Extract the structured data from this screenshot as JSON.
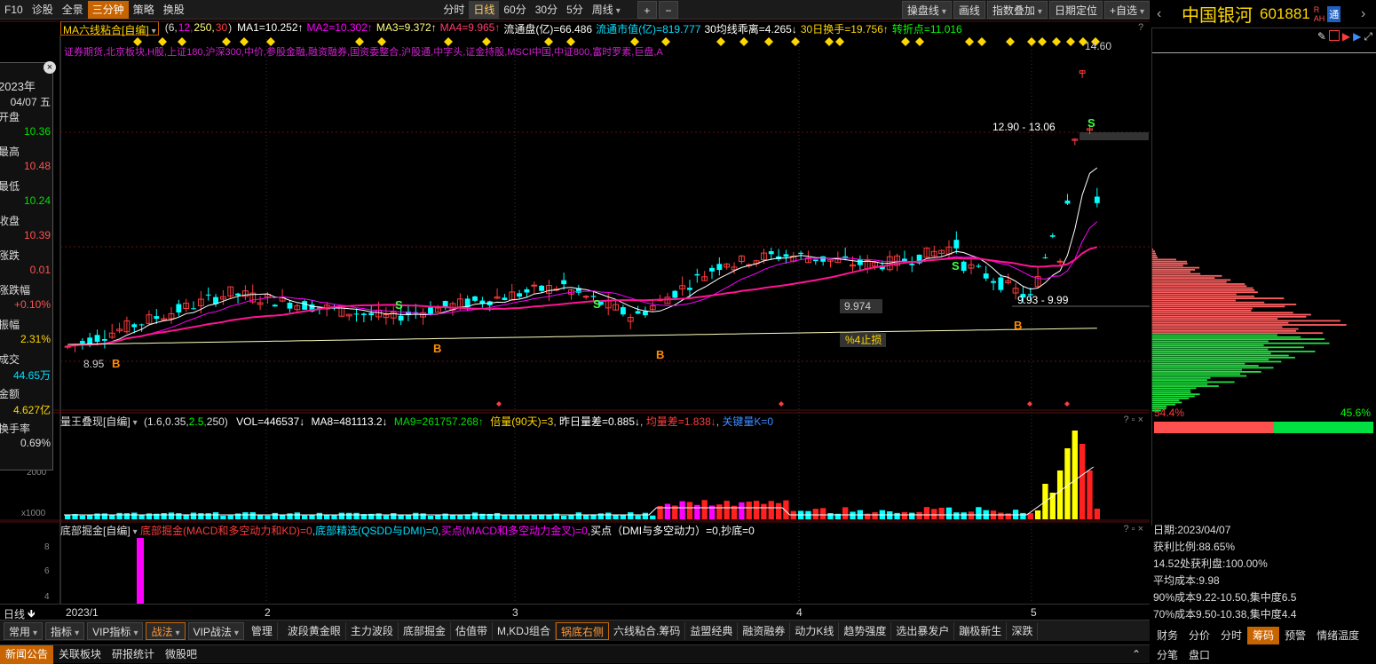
{
  "toolbar": {
    "left": [
      "F10",
      "诊股",
      "全景",
      "三分钟",
      "策略",
      "换股"
    ],
    "active_left": "三分钟",
    "periods": [
      "分时",
      "日线",
      "60分",
      "30分",
      "5分",
      "周线"
    ],
    "active_period": "日线",
    "zoom_in": "+",
    "zoom_out": "−",
    "right": [
      "操盘线",
      "画线",
      "指数叠加",
      "日期定位",
      "+自选"
    ]
  },
  "stock": {
    "name": "中国银河",
    "code": "601881",
    "badge_r": "R",
    "badge_ah": "AH",
    "badge_tong": "通",
    "prev": "‹",
    "next": "›"
  },
  "main_indicator": {
    "name": "MA六线粘合[自编]",
    "params_open": "(6,",
    "p1": "12,",
    "p2": "250,",
    "p3": "30",
    "params_close": ")",
    "ma1": "MA1=10.252↑",
    "ma2": "MA2=10.302↑",
    "ma3": "MA3=9.372↑",
    "ma4": "MA4=9.965↑",
    "float": "流通盘(亿)=66.486",
    "mcap": "流通市值(亿)=819.777",
    "dev": "30均线乖离=4.265↓",
    "turn": "30日换手=19.756↑",
    "pivot": "转折点=11.016",
    "help": "?"
  },
  "tags": "证券期货,北京板块,H股,上证180,沪深300,中价,参股金融,融资融券,国资委整合,沪股通,中字头,证金持股,MSCI中国,中证800,富时罗素,巨盘,A",
  "hq_panel": {
    "year": "2023年",
    "date": "04/07 五",
    "rows": [
      {
        "label": "开盘",
        "value": "10.36",
        "color": "#00e000"
      },
      {
        "label": "最高",
        "value": "10.48",
        "color": "#ff5050"
      },
      {
        "label": "最低",
        "value": "10.24",
        "color": "#00e000"
      },
      {
        "label": "收盘",
        "value": "10.39",
        "color": "#ff5050"
      },
      {
        "label": "涨跌",
        "value": "0.01",
        "color": "#ff5050"
      },
      {
        "label": "涨跌幅",
        "value": "+0.10%",
        "color": "#ff5050"
      },
      {
        "label": "振幅",
        "value": "2.31%",
        "color": "#ffd700"
      },
      {
        "label": "成交",
        "value": "44.65万",
        "color": "#00e0ff"
      },
      {
        "label": "金额",
        "value": "4.627亿",
        "color": "#ffd700"
      },
      {
        "label": "换手率",
        "value": "0.69%",
        "color": "#ddd"
      }
    ],
    "close_icon": "×"
  },
  "chart_labels": {
    "high": "14.60",
    "low": "8.95",
    "zone1": "12.90 - 13.06",
    "zone2": "9.93 - 9.99",
    "ma_val": "9.974",
    "stop": "%4止损",
    "buy": "B",
    "sell": "S"
  },
  "vol_indicator": {
    "name": "量王叠现[自编]",
    "p_open": "(1.6,0.35,",
    "p_hl": "2.5,",
    "p_close": "250)",
    "vol": "VOL=446537↓",
    "ma8": "MA8=481113.2↓",
    "ma9": "MA9=261757.268↑",
    "bei": "倍量(90天)=3",
    "diff": "昨日量差=0.885↓",
    "avg": "均量差=1.838↓",
    "key": "关键量K=0",
    "axis_top": "2000",
    "axis_unit": "x1000"
  },
  "bottom_indicator": {
    "name": "底部掘金[自编]",
    "t1": "底部掘金(MACD和多空动力和KD)=0",
    "t2": "底部精选(QSDD与DMI)=0",
    "t3": "买点(MACD和多空动力金叉)=0",
    "t4": "买点（DMI与多空动力）=0",
    "t5": "抄底=0",
    "y_labels": [
      "8",
      "6",
      "4"
    ]
  },
  "panel_ctl": "? ▫ ×",
  "x_axis": {
    "period_label": "日线",
    "ticks": [
      "2023/1",
      "2",
      "3",
      "4",
      "5"
    ]
  },
  "bottom_groups": [
    "常用",
    "指标",
    "VIP指标",
    "战法",
    "VIP战法"
  ],
  "bottom_manage": "管理",
  "bottom_tabs": [
    "波段黄金眼",
    "主力波段",
    "底部掘金",
    "估值带",
    "M,KDJ组合",
    "锅底右侧",
    "六线粘合.筹码",
    "益盟经典",
    "融资融券",
    "动力K线",
    "趋势强度",
    "选出暴发户",
    "蹦极新生",
    "深跌"
  ],
  "bottom_tab_selected": "锅底右侧",
  "news_tabs": [
    "新闻公告",
    "关联板块",
    "研报统计",
    "微股吧"
  ],
  "news_selected": "新闻公告",
  "news_collapse": "⌃",
  "chips": {
    "left_pct": "54.4%",
    "right_pct": "45.6%",
    "date": "日期:2023/04/07",
    "profit": "获利比例:88.65%",
    "price_profit": "14.52处获利盘:100.00%",
    "avg_cost": "平均成本:9.98",
    "c90": "90%成本9.22-10.50,集中度6.5",
    "c70": "70%成本9.50-10.38,集中度4.4"
  },
  "right_tabs": [
    "财务",
    "分价",
    "分时",
    "筹码",
    "预警",
    "情绪温度"
  ],
  "right_tab_selected": "筹码",
  "right_tabs2": [
    "分笔",
    "盘口"
  ],
  "colors": {
    "up": "#ff3c3c",
    "down": "#00ffff",
    "accent": "#c86400",
    "ma_white": "#ffffff",
    "ma_magenta": "#ff00ff",
    "ma_pink": "#ff1493",
    "ma_yellow": "#ffffc0"
  }
}
